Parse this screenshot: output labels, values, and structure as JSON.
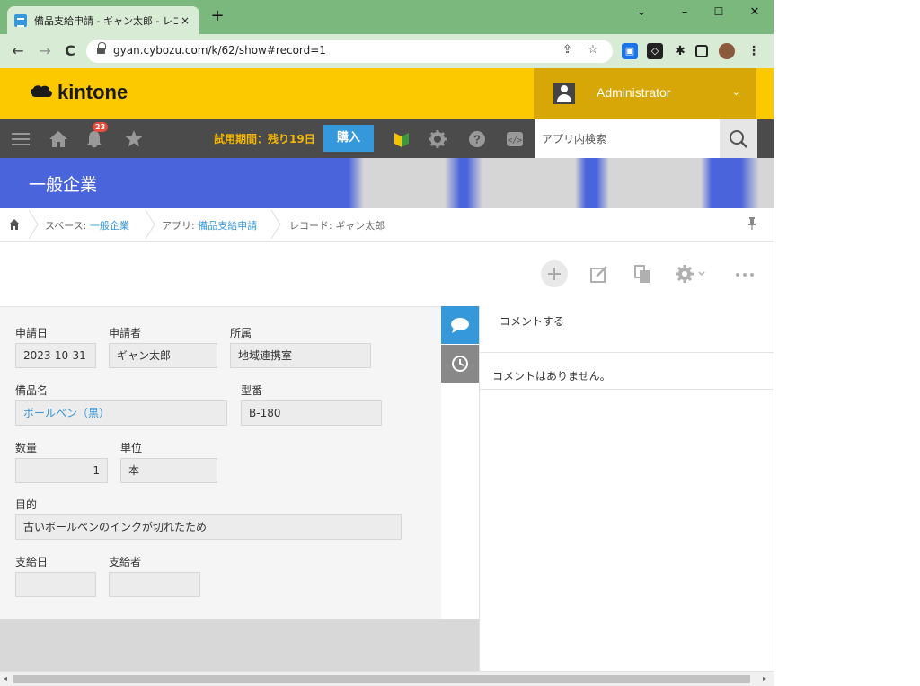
{
  "browser": {
    "tab_title": "備品支給申請 - ギャン太郎 - レコー",
    "tab_close": "×",
    "new_tab": "+",
    "url": "gyan.cybozu.com/k/62/show#record=1",
    "window_controls": [
      "⌄",
      "–",
      "☐",
      "✕"
    ],
    "nav_back": "←",
    "nav_forward": "→",
    "nav_reload": "C",
    "menu": "⋮"
  },
  "kintone": {
    "logo_text": "kintone",
    "user_name": "Administrator",
    "user_chevron": "⌄",
    "notification_count": "23",
    "trial_text": "試用期間：残り19日",
    "buy_label": "購入",
    "search_placeholder": "アプリ内検索"
  },
  "space": {
    "banner_title": "一般企業"
  },
  "breadcrumb": {
    "space_prefix": "スペース: ",
    "space_name": "一般企業",
    "app_prefix": "アプリ: ",
    "app_name": "備品支給申請",
    "record_prefix": "レコード: ",
    "record_name": "ギャン太郎"
  },
  "form": {
    "fields": {
      "apply_date": {
        "label": "申請日",
        "value": "2023-10-31"
      },
      "applicant": {
        "label": "申請者",
        "value": "ギャン太郎"
      },
      "department": {
        "label": "所属",
        "value": "地域連携室"
      },
      "item_name": {
        "label": "備品名",
        "value": "ボールペン（黒）"
      },
      "model_no": {
        "label": "型番",
        "value": "B-180"
      },
      "quantity": {
        "label": "数量",
        "value": "1"
      },
      "unit": {
        "label": "単位",
        "value": "本"
      },
      "purpose": {
        "label": "目的",
        "value": "古いボールペンのインクが切れたため"
      },
      "supply_date": {
        "label": "支給日",
        "value": ""
      },
      "supplier": {
        "label": "支給者",
        "value": ""
      }
    }
  },
  "comments": {
    "placeholder": "コメントする",
    "empty_text": "コメントはありません。"
  },
  "colors": {
    "kintone_yellow": "#fcc800",
    "user_area": "#d6a707",
    "toolbar_dark": "#4b4b4b",
    "accent_blue": "#3498db",
    "banner_blue": "#4a64dc",
    "tab_green": "#7ab87e"
  },
  "icons": {
    "toolbar": [
      "menu-icon",
      "home-icon",
      "bell-icon",
      "star-icon",
      "beginner-mark-icon",
      "gear-icon",
      "help-icon",
      "code-icon"
    ],
    "actions": [
      "add-icon",
      "edit-icon",
      "duplicate-icon",
      "gear-icon",
      "more-icon"
    ]
  }
}
